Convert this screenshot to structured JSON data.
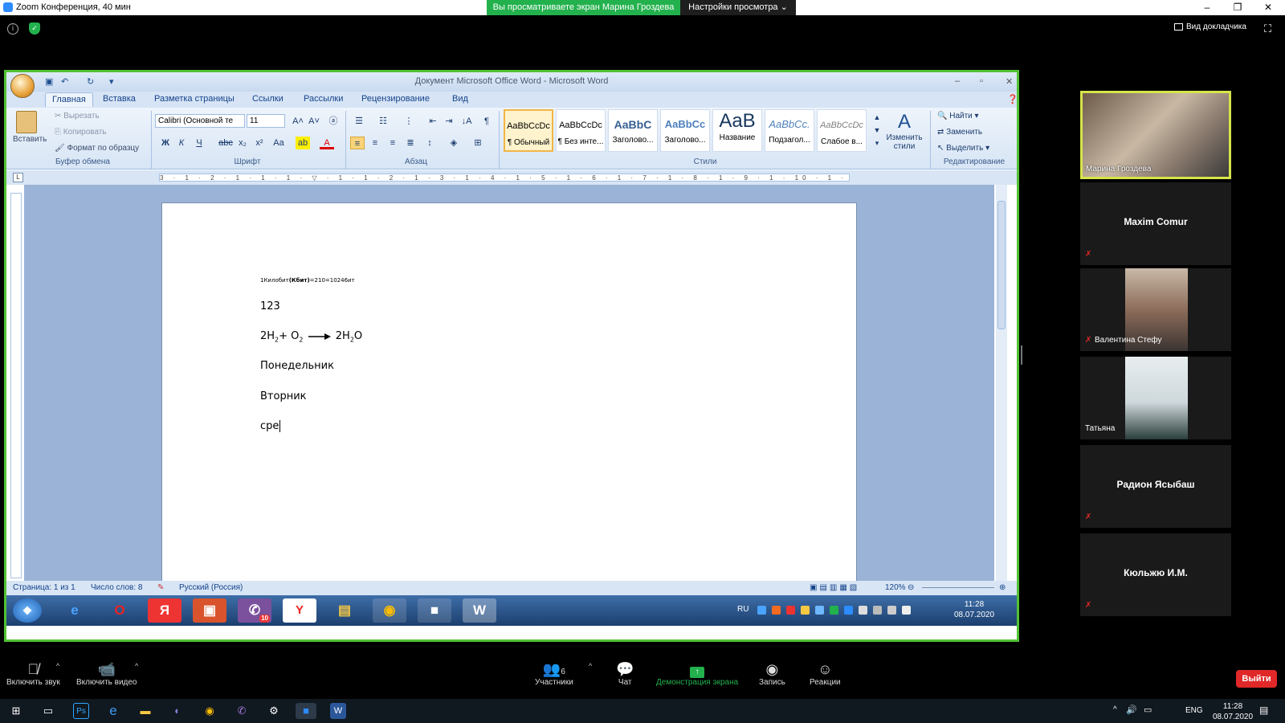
{
  "zoom": {
    "window_title": "Zoom Конференция, 40 мин",
    "share_banner": "Вы просматриваете экран Марина Гроздева",
    "view_settings": "Настройки просмотра ⌄",
    "speaker_view": "Вид докладчика",
    "controls": {
      "mute": "Включить звук",
      "video": "Включить видео",
      "participants": "Участники",
      "participants_count": "6",
      "chat": "Чат",
      "share": "Демонстрация экрана",
      "record": "Запись",
      "reactions": "Реакции",
      "leave": "Выйти"
    }
  },
  "participants": [
    {
      "name": "Марина Гроздева",
      "video": true
    },
    {
      "name": "Maxim Comur",
      "video": false
    },
    {
      "name": "Валентина Стефу",
      "video": true
    },
    {
      "name": "Татьяна",
      "video": true
    },
    {
      "name": "Радион Ясыбаш",
      "video": false
    },
    {
      "name": "Кюльжю И.М.",
      "video": false
    }
  ],
  "word": {
    "title": "Документ Microsoft Office Word - Microsoft Word",
    "tabs": [
      "Главная",
      "Вставка",
      "Разметка страницы",
      "Ссылки",
      "Рассылки",
      "Рецензирование",
      "Вид"
    ],
    "clipboard": {
      "paste": "Вставить",
      "cut": "Вырезать",
      "copy": "Копировать",
      "format_painter": "Формат по образцу",
      "label": "Буфер обмена"
    },
    "font": {
      "name": "Calibri (Основной те",
      "size": "11",
      "label": "Шрифт"
    },
    "paragraph_label": "Абзац",
    "styles": [
      {
        "preview": "AaBbCcDc",
        "name": "¶ Обычный"
      },
      {
        "preview": "AaBbCcDc",
        "name": "¶ Без инте..."
      },
      {
        "preview": "AaBbC",
        "name": "Заголово..."
      },
      {
        "preview": "AaBbCc",
        "name": "Заголово..."
      },
      {
        "preview": "AaB",
        "name": "Название"
      },
      {
        "preview": "AaBbCc.",
        "name": "Подзагол..."
      },
      {
        "preview": "AaBbCcDc",
        "name": "Слабое в..."
      }
    ],
    "styles_label": "Стили",
    "change_styles": "Изменить стили",
    "editing": {
      "find": "Найти",
      "replace": "Заменить",
      "select": "Выделить",
      "label": "Редактирование"
    },
    "ruler_text": "3 · 1 · 2 · 1 · 1 · 1 · ▽ · 1 · 1 · 2 · 1 · 3 · 1 · 4 · 1 · 5 · 1 · 6 · 1 · 7 · 1 · 8 · 1 · 9 · 1 · 10 · 1 · 11 · 1 · 12 · 1 · 13 · 1 · 14 · 1 · 15 · 1 · 16 · △ · 17 ·",
    "document": {
      "line1_a": "1Килобит",
      "line1_b": "(Кбит)",
      "line1_c": "=210=10246ит",
      "line2": "123",
      "line3_a": "2H",
      "line3_b": "2",
      "line3_c": "+ O",
      "line3_d": "2",
      "line3_e": "2H",
      "line3_f": "2",
      "line3_g": "O",
      "line4": "Понедельник",
      "line5": "Вторник",
      "line6": "сре"
    },
    "status": {
      "page": "Страница: 1 из 1",
      "words": "Число слов: 8",
      "language": "Русский (Россия)",
      "zoom": "120%"
    }
  },
  "inner_taskbar": {
    "lang": "RU",
    "time": "11:28",
    "date": "08.07.2020",
    "viber_badge": "10"
  },
  "windows_taskbar": {
    "lang": "ENG",
    "time": "11:28",
    "date": "08.07.2020"
  }
}
